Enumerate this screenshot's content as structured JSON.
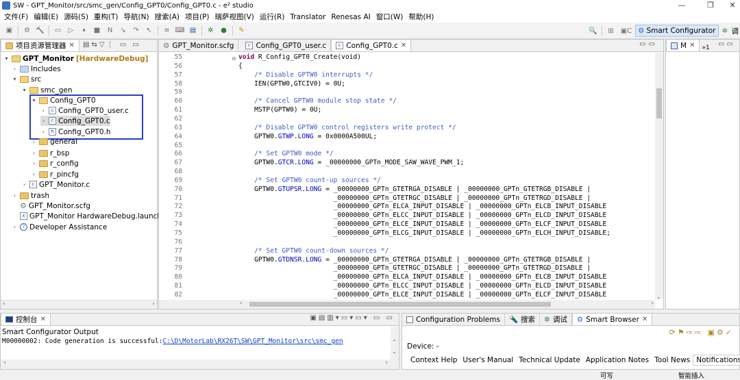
{
  "window": {
    "title": "SW - GPT_Monitor/src/smc_gen/Config_GPT0/Config_GPT0.c - e² studio",
    "minimize": "—",
    "restore": "❐",
    "close": "✕"
  },
  "menu": [
    "文件(F)",
    "编辑(E)",
    "源码(S)",
    "重构(T)",
    "导航(N)",
    "搜索(A)",
    "项目(P)",
    "瑞萨视图(V)",
    "运行(R)",
    "Translator",
    "Renesas AI",
    "窗口(W)",
    "帮助(H)"
  ],
  "toolbar": {
    "perspective_label": "Smart Configurator",
    "debug_label": "调"
  },
  "explorer": {
    "tab_label": "项目资源管理器",
    "items": [
      {
        "label": "GPT_Monitor",
        "suffix": "[HardwareDebug]"
      },
      {
        "label": "Includes"
      },
      {
        "label": "src"
      },
      {
        "label": "smc_gen"
      },
      {
        "label": "Config_GPT0"
      },
      {
        "label": "Config_GPT0_user.c"
      },
      {
        "label": "Config_GPT0.c"
      },
      {
        "label": "Config_GPT0.h"
      },
      {
        "label": "general"
      },
      {
        "label": "r_bsp"
      },
      {
        "label": "r_config"
      },
      {
        "label": "r_pincfg"
      },
      {
        "label": "GPT_Monitor.c"
      },
      {
        "label": "trash"
      },
      {
        "label": "GPT_Monitor.scfg"
      },
      {
        "label": "GPT_Monitor HardwareDebug.launch"
      },
      {
        "label": "Developer Assistance"
      }
    ]
  },
  "editor": {
    "tabs": [
      {
        "label": "GPT_Monitor.scfg"
      },
      {
        "label": "Config_GPT0_user.c"
      },
      {
        "label": "Config_GPT0.c"
      }
    ],
    "line_numbers": [
      "55",
      "56",
      "57",
      "58",
      "59",
      "60",
      "61",
      "62",
      "63",
      "64",
      "65",
      "66",
      "67",
      "68",
      "69",
      "70",
      "71",
      "72",
      "73",
      "74",
      "75",
      "76",
      "77",
      "78",
      "79",
      "80",
      "81",
      "82"
    ],
    "lines": [
      "void R_Config_GPT0_Create(void)",
      "{",
      "    /* Disable GPTW0 interrupts */",
      "    IEN(GPTW0,GTCIV0) = 0U;",
      "",
      "    /* Cancel GPTW0 module stop state */",
      "    MSTP(GPTW0) = 0U;",
      "",
      "    /* Disable GPTW0 control registers write protect */",
      "    GPTW0.GTWP.LONG = 0x0000A500UL;",
      "",
      "    /* Set GPTW0 mode */",
      "    GPTW0.GTCR.LONG = _00000000_GPTn_MODE_SAW_WAVE_PWM_1;",
      "",
      "    /* Set GPTW0 count-up sources */",
      "    GPTW0.GTUPSR.LONG = _00000000_GPTn_GTETRGA_DISABLE | _00000000_GPTn_GTETRGB_DISABLE |",
      "                        _00000000_GPTn_GTETRGC_DISABLE | _00000000_GPTn_GTETRGD_DISABLE |",
      "                        _00000000_GPTn_ELCA_INPUT_DISABLE | _00000000_GPTn_ELCB_INPUT_DISABLE",
      "                        _00000000_GPTn_ELCC_INPUT_DISABLE | _00000000_GPTn_ELCD_INPUT_DISABLE",
      "                        _00000000_GPTn_ELCE_INPUT_DISABLE | _00000000_GPTn_ELCF_INPUT_DISABLE",
      "                        _00000000_GPTn_ELCG_INPUT_DISABLE | _00000000_GPTn_ELCH_INPUT_DISABLE;",
      "",
      "    /* Set GPTW0 count-down sources */",
      "    GPTW0.GTDNSR.LONG = _00000000_GPTn_GTETRGA_DISABLE | _00000000_GPTn_GTETRGB_DISABLE |",
      "                        _00000000_GPTn_GTETRGC_DISABLE | _00000000_GPTn_GTETRGD_DISABLE |",
      "                        _00000000_GPTn_ELCA_INPUT_DISABLE | _00000000_GPTn_ELCB_INPUT_DISABLE",
      "                        _00000000_GPTn_ELCC_INPUT_DISABLE | _00000000_GPTn_ELCD_INPUT_DISABLE",
      "                        _00000000_GPTn_ELCE_INPUT_DISABLE | _00000000_GPTn_ELCF_INPUT_DISABLE"
    ]
  },
  "outline": {
    "tab_label": "M",
    "overflow": "»1"
  },
  "console": {
    "tab_label": "控制台",
    "title": "Smart Configurator Output",
    "message_prefix": "M00000002: Code generation is successful:",
    "message_link": "C:\\D\\MotorLab\\RX26T\\SW\\GPT_Monitor\\src\\smc_gen"
  },
  "right_bottom": {
    "tabs": [
      {
        "label": "Configuration Problems"
      },
      {
        "label": "搜索"
      },
      {
        "label": "调试"
      },
      {
        "label": "Smart Browser"
      }
    ],
    "device_label": "Device: -",
    "subtabs": [
      "Context Help",
      "User's Manual",
      "Technical Update",
      "Application Notes",
      "Tool News",
      "Notifications"
    ]
  },
  "status": {
    "writable": "可写",
    "insert_mode": "智能插入"
  },
  "colors": {
    "highlight_box": "#2b3fbf",
    "comment": "#3f5fbf",
    "keyword": "#7f0055",
    "field": "#0000c0"
  }
}
